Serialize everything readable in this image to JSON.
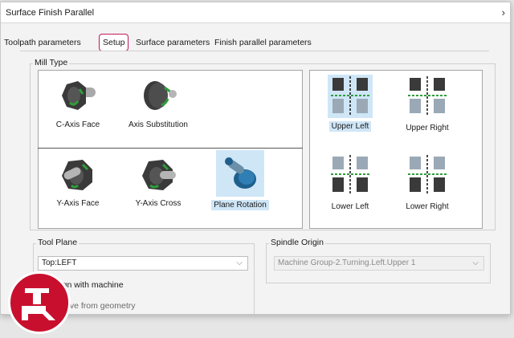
{
  "window": {
    "title": "Surface Finish Parallel",
    "chevron": "›"
  },
  "tabs": [
    {
      "label": "Toolpath parameters"
    },
    {
      "label": "Setup"
    },
    {
      "label": "Surface parameters"
    },
    {
      "label": "Finish parallel parameters"
    }
  ],
  "mill_type": {
    "label": "Mill Type",
    "items": [
      {
        "label": "C-Axis Face",
        "icon": "c-axis-face-icon"
      },
      {
        "label": "Axis Substitution",
        "icon": "axis-substitution-icon"
      },
      {
        "label": "Y-Axis Face",
        "icon": "y-axis-face-icon"
      },
      {
        "label": "Y-Axis Cross",
        "icon": "y-axis-cross-icon"
      },
      {
        "label": "Plane Rotation",
        "icon": "plane-rotation-icon",
        "selected": true
      }
    ]
  },
  "positions": {
    "items": [
      {
        "label": "Upper Left",
        "selected": true
      },
      {
        "label": "Upper Right"
      },
      {
        "label": "Lower Left"
      },
      {
        "label": "Lower Right"
      }
    ]
  },
  "tool_plane": {
    "label": "Tool Plane",
    "value": "Top:LEFT"
  },
  "spindle_origin": {
    "label": "Spindle Origin",
    "value": "Machine Group-2.Turning.Left.Upper 1"
  },
  "options": {
    "align_label": "lign with machine",
    "derive_label": "rive from geometry"
  },
  "colors": {
    "accent": "#c2185b",
    "selection": "#cfe6f7",
    "logo": "#c8102e"
  }
}
